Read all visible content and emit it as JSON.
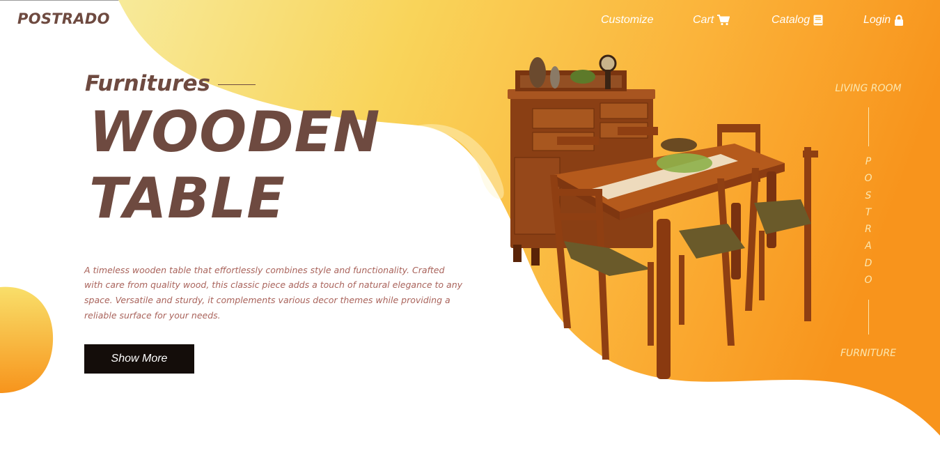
{
  "brand": {
    "logo": "POSTRADO"
  },
  "nav": {
    "items": [
      {
        "label": "Customize",
        "icon": ""
      },
      {
        "label": "Cart",
        "icon": "cart-icon"
      },
      {
        "label": "Catalog",
        "icon": "book-icon"
      },
      {
        "label": "Login",
        "icon": "lock-icon"
      }
    ]
  },
  "hero": {
    "subtitle": "Furnitures",
    "title_line1": "WOODEN",
    "title_line2": "TABLE",
    "description": "A timeless wooden table that effortlessly combines style and functionality. Crafted with care from quality wood, this classic piece adds a touch of natural elegance to any space. Versatile and sturdy, it complements various decor themes while providing a reliable surface for your needs.",
    "button_label": "Show More"
  },
  "side": {
    "top_label": "LIVING ROOM",
    "letters": [
      "P",
      "O",
      "S",
      "T",
      "R",
      "A",
      "D",
      "O"
    ],
    "bottom_label": "FURNITURE"
  },
  "colors": {
    "brand_brown": "#6e4a40",
    "description_text": "#a9635b",
    "gradient_light": "#f6e89a",
    "gradient_orange": "#f7941d",
    "button_bg": "#140d0a"
  }
}
